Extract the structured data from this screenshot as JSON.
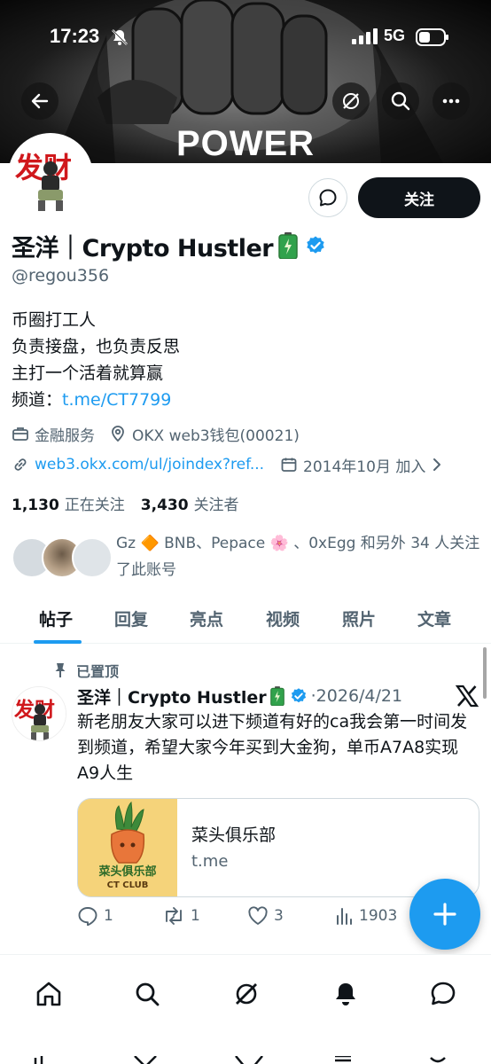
{
  "status_bar": {
    "time": "17:23",
    "network": "5G"
  },
  "banner": {
    "text": "POWER"
  },
  "profile": {
    "display_name": "圣洋｜Crypto Hustler",
    "handle": "@regou356",
    "avatar_text": "发财",
    "follow_label": "关注",
    "bio_lines": [
      "币圈打工人",
      "负责接盘，也负责反思",
      "主打一个活着就算赢"
    ],
    "bio_channel_label": "频道：",
    "bio_channel_link": "t.me/CT7799",
    "category": "金融服务",
    "location": "OKX web3钱包(00021)",
    "website": "web3.okx.com/ul/joindex?ref...",
    "joined": "2014年10月 加入",
    "following_count": "1,130",
    "following_label": "正在关注",
    "followers_count": "3,430",
    "followers_label": "关注者",
    "known_followers_text": "Gz 🔶 BNB、Pepace 🌸 、0xEgg 和另外 34 人关注了此账号"
  },
  "tabs": [
    "帖子",
    "回复",
    "亮点",
    "视频",
    "照片",
    "文章"
  ],
  "active_tab": "帖子",
  "pinned_tweet": {
    "pinned_label": "已置顶",
    "author": "圣洋｜Crypto Hustler",
    "date": "·2026/4/21",
    "text": "新老朋友大家可以进下频道有好的ca我会第一时间发到频道，希望大家今年买到大金狗，单币A7A8实现A9人生",
    "card": {
      "image_title": "菜头俱乐部",
      "image_subtitle": "CT CLUB",
      "title": "菜头俱乐部",
      "domain": "t.me"
    },
    "replies": "1",
    "reposts": "1",
    "likes": "3",
    "views": "1903"
  },
  "colors": {
    "accent": "#1d9bf0",
    "text": "#0f1419",
    "muted": "#536471",
    "verified": "#1d9bf0",
    "battery_green": "#31a24c"
  },
  "icons": [
    "back-arrow-icon",
    "grok-icon",
    "search-icon",
    "more-icon",
    "message-icon",
    "verified-badge-icon",
    "battery-emoji-icon",
    "briefcase-icon",
    "location-pin-icon",
    "link-icon",
    "calendar-icon",
    "chevron-right-icon",
    "pin-icon",
    "x-logo-icon",
    "reply-icon",
    "repost-icon",
    "like-icon",
    "views-icon",
    "compose-plus-icon",
    "home-icon",
    "explore-icon",
    "grok-nav-icon",
    "notifications-icon",
    "messages-icon"
  ]
}
